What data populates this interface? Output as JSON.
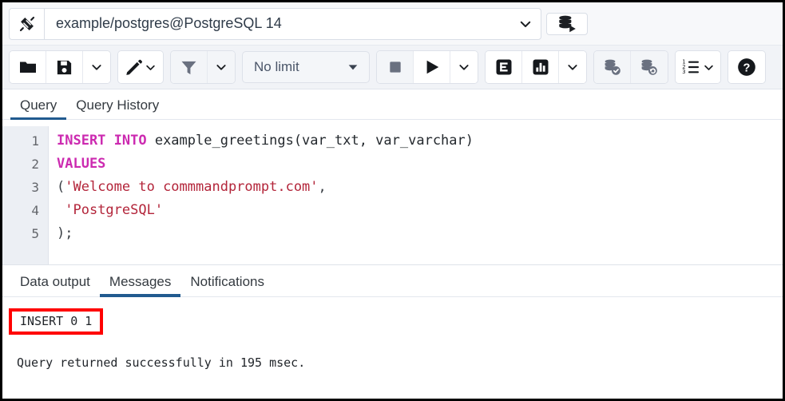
{
  "connection": {
    "plug_icon": "connected-plug-icon",
    "title": "example/postgres@PostgreSQL 14",
    "chevron_icon": "chevron-down-icon",
    "db_button_icon": "database-connect-icon"
  },
  "toolbar": {
    "open_file_label": "folder-open-icon",
    "save_file_label": "save-icon",
    "save_caret_label": "chevron-down-icon",
    "edit_label": "pencil-icon",
    "edit_caret_label": "chevron-down-icon",
    "filter_label": "filter-funnel-icon",
    "filter_caret_label": "chevron-down-icon",
    "row_limit_value": "No limit",
    "row_limit_caret": "triangle-down-icon",
    "stop_label": "stop-square-icon",
    "execute_label": "play-triangle-icon",
    "execute_caret_label": "chevron-down-icon",
    "explain_label": "explain-e-icon",
    "explain_analyze_label": "explain-analyze-chart-icon",
    "explain_caret_label": "chevron-down-icon",
    "commit_label": "commit-database-check-icon",
    "rollback_label": "rollback-database-undo-icon",
    "macros_label": "macros-list-icon",
    "macros_caret_label": "chevron-down-icon",
    "help_label": "help-question-icon"
  },
  "query_tabs": [
    {
      "label": "Query",
      "active": true
    },
    {
      "label": "Query History",
      "active": false
    }
  ],
  "editor": {
    "line_numbers": [
      "1",
      "2",
      "3",
      "4",
      "5"
    ],
    "lines": [
      {
        "tokens": [
          {
            "t": "INSERT INTO",
            "c": "kw"
          },
          {
            "t": " example_greetings(var_txt, var_varchar)",
            "c": "id"
          }
        ]
      },
      {
        "tokens": [
          {
            "t": "VALUES",
            "c": "kw"
          }
        ]
      },
      {
        "tokens": [
          {
            "t": "(",
            "c": "punc"
          },
          {
            "t": "'Welcome to commmandprompt.com'",
            "c": "str"
          },
          {
            "t": ",",
            "c": "punc"
          }
        ]
      },
      {
        "tokens": [
          {
            "t": " ",
            "c": "punc"
          },
          {
            "t": "'PostgreSQL'",
            "c": "str"
          }
        ]
      },
      {
        "tokens": [
          {
            "t": ");",
            "c": "punc"
          }
        ]
      }
    ]
  },
  "output_tabs": [
    {
      "label": "Data output",
      "active": false
    },
    {
      "label": "Messages",
      "active": true
    },
    {
      "label": "Notifications",
      "active": false
    }
  ],
  "messages": {
    "result": "INSERT 0 1",
    "status": "Query returned successfully in 195 msec."
  },
  "colors": {
    "accent_tab_underline": "#215a8f",
    "highlight_box": "#ff0000",
    "keyword": "#cc2ab0",
    "string": "#b3253a",
    "gutter_bg": "#eceff4",
    "toolbar_bg": "#f1f3f7"
  }
}
